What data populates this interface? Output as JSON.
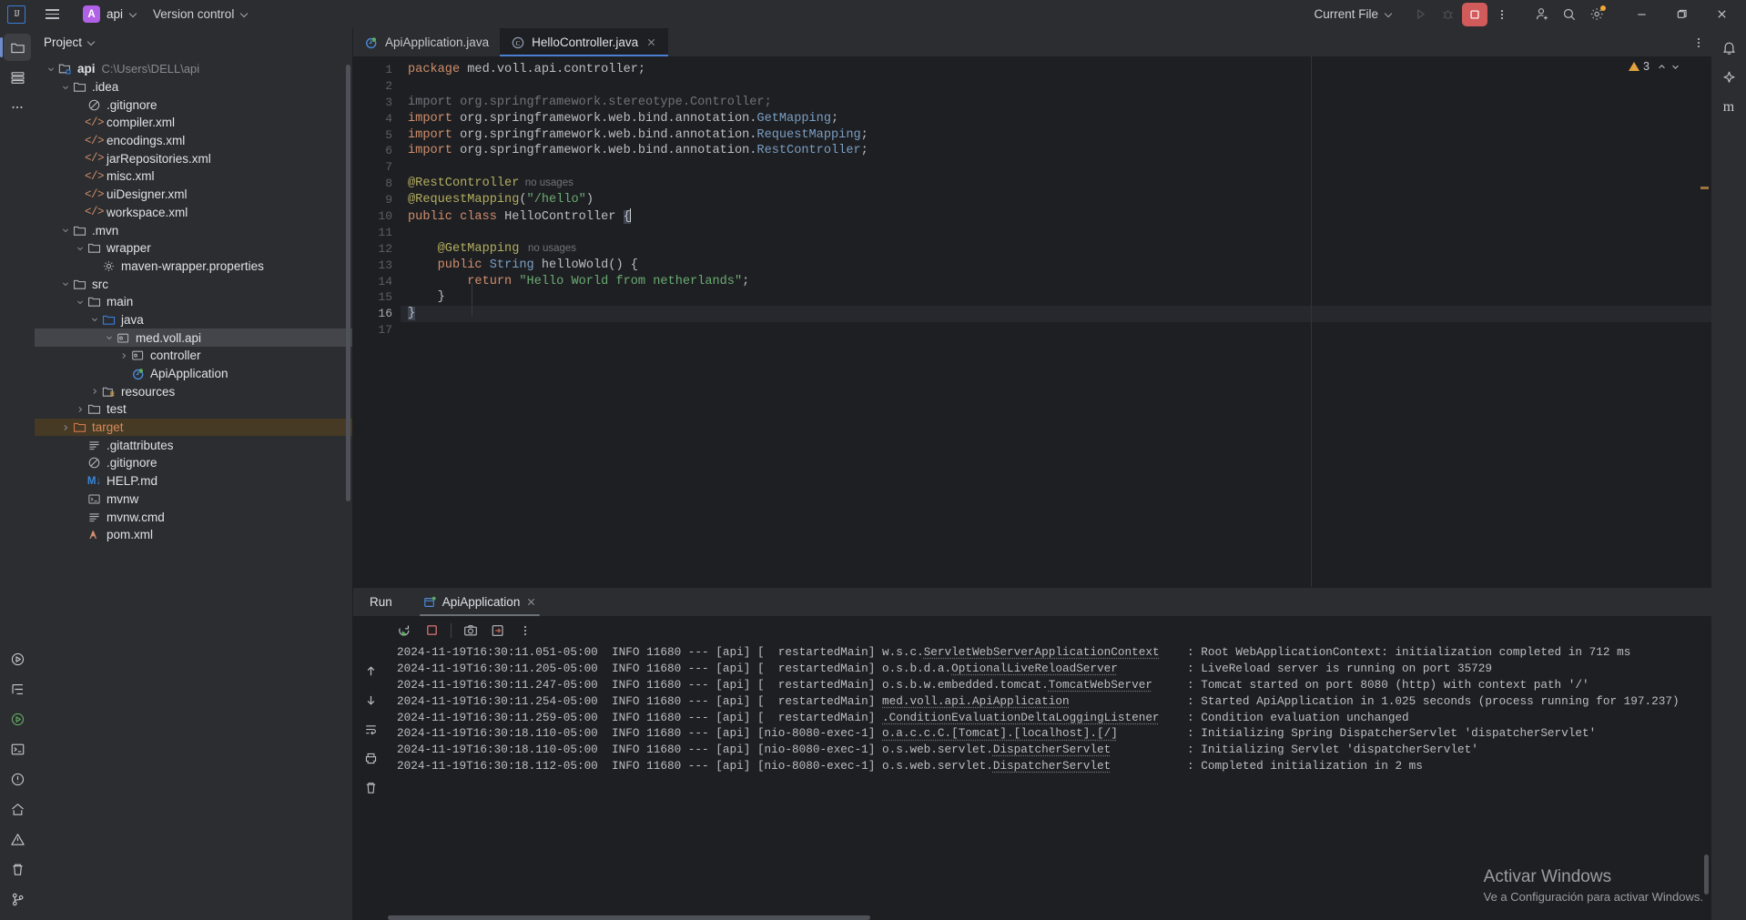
{
  "titlebar": {
    "menu_icon": "hamburger-icon",
    "project_badge": "A",
    "project_name": "api",
    "version_control": "Version control",
    "current_file": "Current File",
    "run_icon": "run-icon",
    "debug_icon": "debug-icon",
    "stop_icon": "stop-icon",
    "more_icon": "more-vertical-icon",
    "account_icon": "account-add-icon",
    "search_icon": "search-icon",
    "settings_icon": "gear-icon",
    "minimize_icon": "minimize-icon",
    "maximize_icon": "maximize-icon",
    "close_icon": "close-icon",
    "accent": "#b160e8",
    "stop_color": "#d15a5a"
  },
  "activity_bar": {
    "left": [
      {
        "name": "project-tool-window",
        "icon": "folder-icon",
        "selected": true
      },
      {
        "name": "commit-tool-window",
        "icon": "commit-icon",
        "selected": false
      },
      {
        "name": "more-tool-windows",
        "icon": "ellipsis-icon",
        "selected": false
      }
    ],
    "left_bottom": [
      {
        "name": "run-tool-window",
        "icon": "play-circle-icon"
      },
      {
        "name": "structure-tool-window",
        "icon": "structure-icon"
      },
      {
        "name": "debug-tool-window",
        "icon": "debug-run-icon"
      },
      {
        "name": "terminal-tool-window",
        "icon": "terminal-icon"
      },
      {
        "name": "problems-tool-window",
        "icon": "problems-icon"
      },
      {
        "name": "services-tool-window",
        "icon": "services-icon"
      },
      {
        "name": "warnings-tool-window",
        "icon": "warning-icon"
      },
      {
        "name": "delete-tool",
        "icon": "trash-icon"
      },
      {
        "name": "version-control-tool-window",
        "icon": "branch-icon"
      }
    ],
    "right": [
      {
        "name": "notifications",
        "icon": "bell-icon"
      },
      {
        "name": "ai-assistant",
        "icon": "ai-icon"
      },
      {
        "name": "maven-tool-window",
        "icon": "maven-m-icon"
      }
    ]
  },
  "project_panel": {
    "title": "Project",
    "chevron": "chevron-down-icon",
    "tree": [
      {
        "label": "api",
        "sub": "C:\\Users\\DELL\\api",
        "depth": 0,
        "arrow": "down",
        "icon": "module-folder-icon",
        "bold": true
      },
      {
        "label": ".idea",
        "depth": 1,
        "arrow": "down",
        "icon": "folder-icon"
      },
      {
        "label": ".gitignore",
        "depth": 2,
        "arrow": "none",
        "icon": "gitignore-icon"
      },
      {
        "label": "compiler.xml",
        "depth": 2,
        "arrow": "none",
        "icon": "xml-icon"
      },
      {
        "label": "encodings.xml",
        "depth": 2,
        "arrow": "none",
        "icon": "xml-icon"
      },
      {
        "label": "jarRepositories.xml",
        "depth": 2,
        "arrow": "none",
        "icon": "xml-icon"
      },
      {
        "label": "misc.xml",
        "depth": 2,
        "arrow": "none",
        "icon": "xml-icon"
      },
      {
        "label": "uiDesigner.xml",
        "depth": 2,
        "arrow": "none",
        "icon": "xml-icon"
      },
      {
        "label": "workspace.xml",
        "depth": 2,
        "arrow": "none",
        "icon": "xml-icon"
      },
      {
        "label": ".mvn",
        "depth": 1,
        "arrow": "down",
        "icon": "folder-icon"
      },
      {
        "label": "wrapper",
        "depth": 2,
        "arrow": "down",
        "icon": "folder-icon"
      },
      {
        "label": "maven-wrapper.properties",
        "depth": 3,
        "arrow": "none",
        "icon": "properties-icon"
      },
      {
        "label": "src",
        "depth": 1,
        "arrow": "down",
        "icon": "folder-icon"
      },
      {
        "label": "main",
        "depth": 2,
        "arrow": "down",
        "icon": "folder-icon"
      },
      {
        "label": "java",
        "depth": 3,
        "arrow": "down",
        "icon": "source-root-icon"
      },
      {
        "label": "med.voll.api",
        "depth": 4,
        "arrow": "down",
        "icon": "package-icon",
        "selected": true
      },
      {
        "label": "controller",
        "depth": 5,
        "arrow": "right",
        "icon": "package-icon"
      },
      {
        "label": "ApiApplication",
        "depth": 5,
        "arrow": "none",
        "icon": "spring-class-icon"
      },
      {
        "label": "resources",
        "depth": 3,
        "arrow": "right",
        "icon": "resources-folder-icon"
      },
      {
        "label": "test",
        "depth": 2,
        "arrow": "right",
        "icon": "folder-icon"
      },
      {
        "label": "target",
        "depth": 1,
        "arrow": "right",
        "icon": "excluded-folder-icon",
        "excluded": true
      },
      {
        "label": ".gitattributes",
        "depth": 2,
        "arrow": "none",
        "icon": "text-file-icon"
      },
      {
        "label": ".gitignore",
        "depth": 2,
        "arrow": "none",
        "icon": "gitignore-icon"
      },
      {
        "label": "HELP.md",
        "depth": 2,
        "arrow": "none",
        "icon": "markdown-icon"
      },
      {
        "label": "mvnw",
        "depth": 2,
        "arrow": "none",
        "icon": "shell-script-icon"
      },
      {
        "label": "mvnw.cmd",
        "depth": 2,
        "arrow": "none",
        "icon": "text-file-icon"
      },
      {
        "label": "pom.xml",
        "depth": 2,
        "arrow": "none",
        "icon": "maven-icon"
      }
    ]
  },
  "editor": {
    "tabs": [
      {
        "label": "ApiApplication.java",
        "icon": "spring-class-icon",
        "active": false,
        "closable": false
      },
      {
        "label": "HelloController.java",
        "icon": "java-class-icon",
        "active": true,
        "closable": true
      }
    ],
    "more_icon": "more-vertical-icon",
    "inspection": {
      "count": "3",
      "icon": "warning-triangle-icon",
      "up_icon": "chevron-up-icon",
      "down_icon": "chevron-down-icon"
    },
    "line_numbers": [
      "1",
      "2",
      "3",
      "4",
      "5",
      "6",
      "7",
      "8",
      "9",
      "10",
      "11",
      "12",
      "13",
      "14",
      "15",
      "16",
      "17"
    ],
    "current_line": 16,
    "code": [
      {
        "n": 1,
        "tokens": [
          {
            "t": "package",
            "c": "kw"
          },
          {
            "t": " med.voll.api.controller;",
            "c": "plain"
          }
        ]
      },
      {
        "n": 2,
        "tokens": []
      },
      {
        "n": 3,
        "tokens": [
          {
            "t": "import org.springframework.stereotype.Controller;",
            "c": "dim"
          }
        ]
      },
      {
        "n": 4,
        "tokens": [
          {
            "t": "import",
            "c": "kw"
          },
          {
            "t": " org.springframework.web.bind.annotation.",
            "c": "plain"
          },
          {
            "t": "GetMapping",
            "c": "typ"
          },
          {
            "t": ";",
            "c": "plain"
          }
        ]
      },
      {
        "n": 5,
        "tokens": [
          {
            "t": "import",
            "c": "kw"
          },
          {
            "t": " org.springframework.web.bind.annotation.",
            "c": "plain"
          },
          {
            "t": "RequestMapping",
            "c": "typ"
          },
          {
            "t": ";",
            "c": "plain"
          }
        ]
      },
      {
        "n": 6,
        "tokens": [
          {
            "t": "import",
            "c": "kw"
          },
          {
            "t": " org.springframework.web.bind.annotation.",
            "c": "plain"
          },
          {
            "t": "RestController",
            "c": "typ"
          },
          {
            "t": ";",
            "c": "plain"
          }
        ]
      },
      {
        "n": 7,
        "tokens": []
      },
      {
        "n": 8,
        "tokens": [
          {
            "t": "@RestController",
            "c": "ann"
          },
          {
            "t": "  no usages",
            "c": "hint"
          }
        ]
      },
      {
        "n": 9,
        "tokens": [
          {
            "t": "@RequestMapping",
            "c": "ann"
          },
          {
            "t": "(",
            "c": "plain"
          },
          {
            "t": "\"/hello\"",
            "c": "str"
          },
          {
            "t": ")",
            "c": "plain"
          }
        ]
      },
      {
        "n": 10,
        "tokens": [
          {
            "t": "public class",
            "c": "kw"
          },
          {
            "t": " HelloController ",
            "c": "plain"
          },
          {
            "t": "{",
            "c": "selbrace"
          }
        ]
      },
      {
        "n": 11,
        "tokens": []
      },
      {
        "n": 12,
        "tokens": [
          {
            "t": "    @GetMapping",
            "c": "ann"
          },
          {
            "t": "   no usages",
            "c": "hint"
          }
        ]
      },
      {
        "n": 13,
        "tokens": [
          {
            "t": "    ",
            "c": "plain"
          },
          {
            "t": "public",
            "c": "kw"
          },
          {
            "t": " ",
            "c": "plain"
          },
          {
            "t": "String",
            "c": "typ"
          },
          {
            "t": " helloWold() {",
            "c": "plain"
          }
        ]
      },
      {
        "n": 14,
        "tokens": [
          {
            "t": "        ",
            "c": "plain"
          },
          {
            "t": "return",
            "c": "kw"
          },
          {
            "t": " ",
            "c": "plain"
          },
          {
            "t": "\"Hello World from netherlands\"",
            "c": "str"
          },
          {
            "t": ";",
            "c": "plain"
          }
        ]
      },
      {
        "n": 15,
        "tokens": [
          {
            "t": "    }",
            "c": "plain"
          }
        ]
      },
      {
        "n": 16,
        "tokens": [
          {
            "t": "}",
            "c": "selbrace"
          }
        ]
      },
      {
        "n": 17,
        "tokens": []
      }
    ]
  },
  "run_panel": {
    "title": "Run",
    "tab": {
      "label": "ApiApplication",
      "icon": "run-config-icon",
      "close_icon": "close-icon"
    },
    "toolbar": [
      {
        "name": "rerun-button",
        "icon": "rerun-icon"
      },
      {
        "name": "stop-button",
        "icon": "stop-square-icon"
      },
      {
        "name": "screenshot-button",
        "icon": "camera-icon"
      },
      {
        "name": "export-button",
        "icon": "export-icon"
      },
      {
        "name": "more-options-button",
        "icon": "more-vertical-icon"
      }
    ],
    "side_toolbar": [
      {
        "name": "scroll-up-button",
        "icon": "arrow-up-icon"
      },
      {
        "name": "scroll-down-button",
        "icon": "arrow-down-icon"
      },
      {
        "name": "soft-wrap-button",
        "icon": "wrap-icon"
      },
      {
        "name": "print-button",
        "icon": "print-icon"
      },
      {
        "name": "clear-all-button",
        "icon": "trash-icon"
      }
    ],
    "log_lines": [
      {
        "ts": "2024-11-19T16:30:11.051-05:00",
        "level": "INFO",
        "pid": "11680",
        "app": "[api]",
        "thread": "[  restartedMain]",
        "logger": "w.s.c.ServletWebServerApplicationContext",
        "message": "Root WebApplicationContext: initialization completed in 712 ms",
        "underline": "ServletWebServerApplicationContext"
      },
      {
        "ts": "2024-11-19T16:30:11.205-05:00",
        "level": "INFO",
        "pid": "11680",
        "app": "[api]",
        "thread": "[  restartedMain]",
        "logger": "o.s.b.d.a.OptionalLiveReloadServer",
        "message": "LiveReload server is running on port 35729",
        "underline": "OptionalLiveReloadServer"
      },
      {
        "ts": "2024-11-19T16:30:11.247-05:00",
        "level": "INFO",
        "pid": "11680",
        "app": "[api]",
        "thread": "[  restartedMain]",
        "logger": "o.s.b.w.embedded.tomcat.TomcatWebServer",
        "message": "Tomcat started on port 8080 (http) with context path '/'",
        "underline": "TomcatWebServer"
      },
      {
        "ts": "2024-11-19T16:30:11.254-05:00",
        "level": "INFO",
        "pid": "11680",
        "app": "[api]",
        "thread": "[  restartedMain]",
        "logger": "med.voll.api.ApiApplication",
        "message": "Started ApiApplication in 1.025 seconds (process running for 197.237)",
        "underline": "med.voll.api.ApiApplication"
      },
      {
        "ts": "2024-11-19T16:30:11.259-05:00",
        "level": "INFO",
        "pid": "11680",
        "app": "[api]",
        "thread": "[  restartedMain]",
        "logger": ".ConditionEvaluationDeltaLoggingListener",
        "message": "Condition evaluation unchanged",
        "underline": ".ConditionEvaluationDeltaLoggingListener"
      },
      {
        "ts": "2024-11-19T16:30:18.110-05:00",
        "level": "INFO",
        "pid": "11680",
        "app": "[api]",
        "thread": "[nio-8080-exec-1]",
        "logger": "o.a.c.c.C.[Tomcat].[localhost].[/]",
        "message": "Initializing Spring DispatcherServlet 'dispatcherServlet'",
        "underline": "o.a.c.c.C.[Tomcat].[localhost].[/]"
      },
      {
        "ts": "2024-11-19T16:30:18.110-05:00",
        "level": "INFO",
        "pid": "11680",
        "app": "[api]",
        "thread": "[nio-8080-exec-1]",
        "logger": "o.s.web.servlet.DispatcherServlet",
        "message": "Initializing Servlet 'dispatcherServlet'",
        "underline": "DispatcherServlet"
      },
      {
        "ts": "2024-11-19T16:30:18.112-05:00",
        "level": "INFO",
        "pid": "11680",
        "app": "[api]",
        "thread": "[nio-8080-exec-1]",
        "logger": "o.s.web.servlet.DispatcherServlet",
        "message": "Completed initialization in 2 ms",
        "underline": "DispatcherServlet"
      }
    ]
  },
  "watermark": {
    "line1": "Activar Windows",
    "line2": "Ve a Configuración para activar Windows."
  }
}
